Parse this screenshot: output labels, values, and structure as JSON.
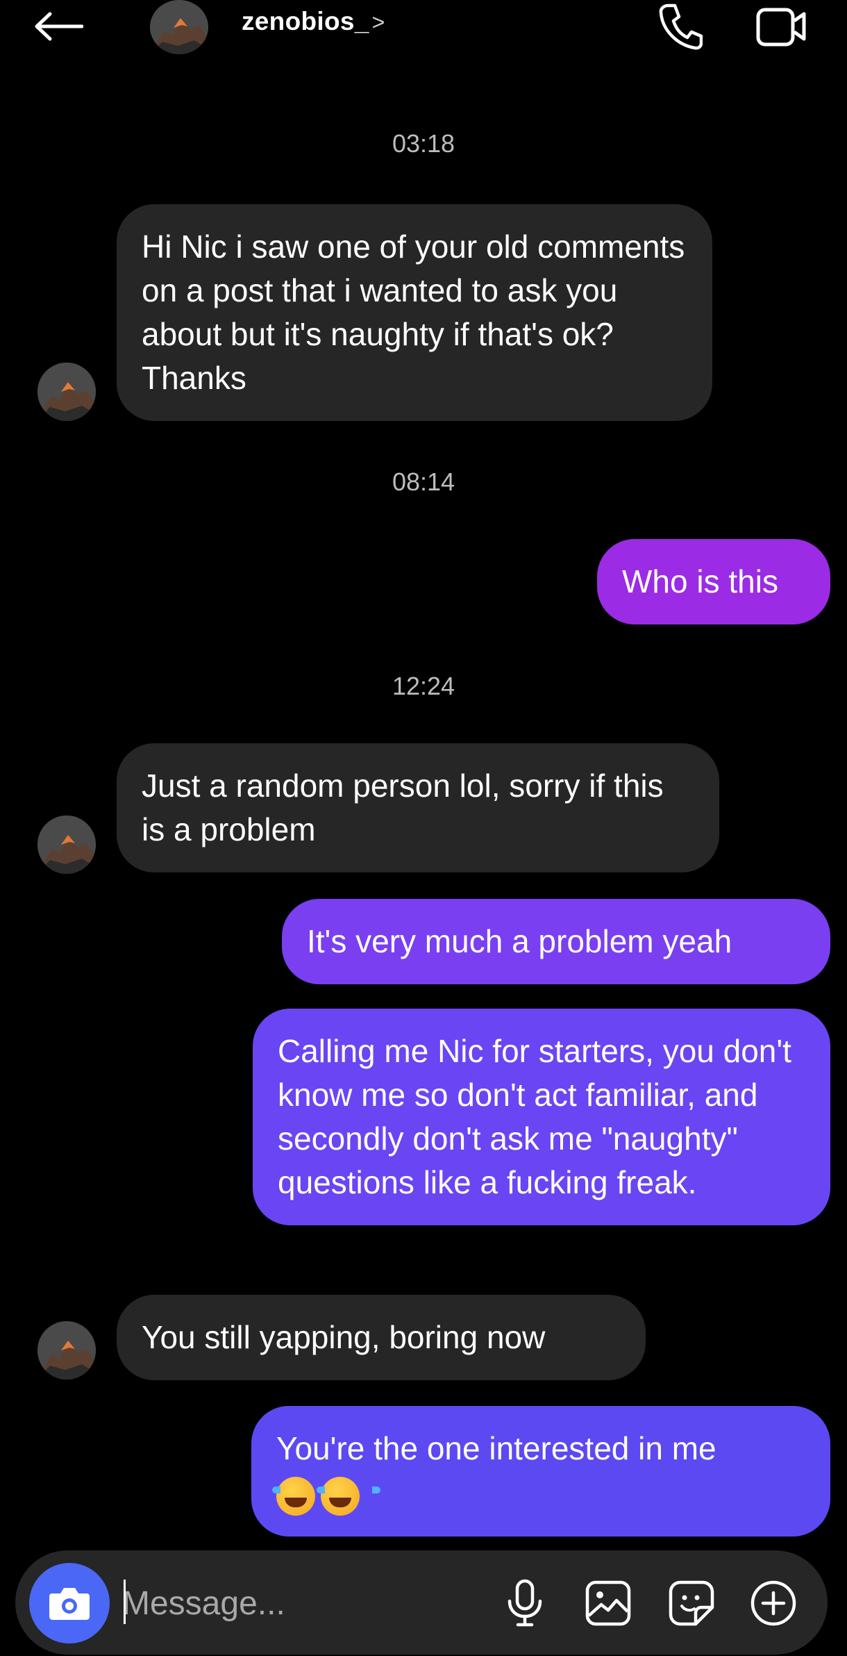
{
  "header": {
    "username": "zenobios_",
    "chevron": ">",
    "icons": {
      "back": "back-arrow-icon",
      "call": "phone-icon",
      "video": "video-camera-icon"
    }
  },
  "timestamps": [
    "03:18",
    "08:14",
    "12:24"
  ],
  "messages": [
    {
      "from": "them",
      "text": "Hi Nic i saw one of your old comments on a post that i wanted to ask you about but it's naughty if that's ok? Thanks"
    },
    {
      "from": "me",
      "text": "Who is this"
    },
    {
      "from": "them",
      "text": "Just a random person lol, sorry if this is a problem"
    },
    {
      "from": "me",
      "text": "It's very much a problem yeah"
    },
    {
      "from": "me",
      "text": "Calling me Nic for starters, you don't know me so don't act familiar, and secondly don't ask me \"naughty\" questions like a fucking freak."
    },
    {
      "from": "them",
      "text": "You still yapping, boring now"
    },
    {
      "from": "me",
      "text": "You're the one interested in me",
      "emoji": "😂😂"
    }
  ],
  "composer": {
    "placeholder": "Message...",
    "icons": [
      "camera-icon",
      "microphone-icon",
      "gallery-icon",
      "sticker-icon",
      "add-icon"
    ]
  },
  "colors": {
    "background": "#000000",
    "incoming_bubble": "#262626",
    "outgoing_1": "#9b2be4",
    "outgoing_2": "#7a3ff0",
    "outgoing_3": "#6a45f3",
    "outgoing_4": "#5d49f2",
    "camera_button": "#4a68f5"
  }
}
